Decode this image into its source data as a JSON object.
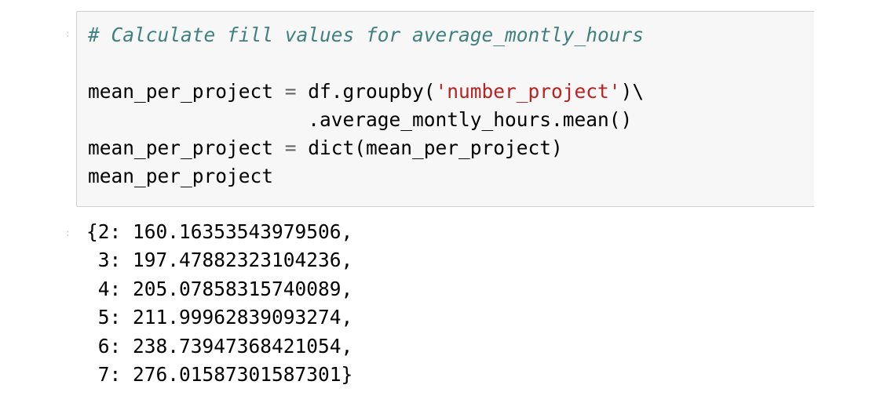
{
  "input_cell": {
    "prompt": ":",
    "lines": {
      "comment": "# Calculate fill values for average_montly_hours",
      "l3_var": "mean_per_project",
      "l3_eq": " = ",
      "l3_call": "df.groupby(",
      "l3_str": "'number_project'",
      "l3_close": ")\\",
      "l4_indent": "                   ",
      "l4_text": ".average_montly_hours.mean()",
      "l5_var": "mean_per_project",
      "l5_eq": " = ",
      "l5_text": "dict(mean_per_project)",
      "l6_text": "mean_per_project"
    }
  },
  "output_cell": {
    "prompt": ":",
    "rows": [
      "{2: 160.16353543979506,",
      " 3: 197.47882323104236,",
      " 4: 205.07858315740089,",
      " 5: 211.99962839093274,",
      " 6: 238.73947368421054,",
      " 7: 276.01587301587301}"
    ]
  },
  "colors": {
    "comment": "#408080",
    "string": "#ba2121",
    "cell_background": "#f7f7f7",
    "cell_border": "#cfcfcf"
  }
}
